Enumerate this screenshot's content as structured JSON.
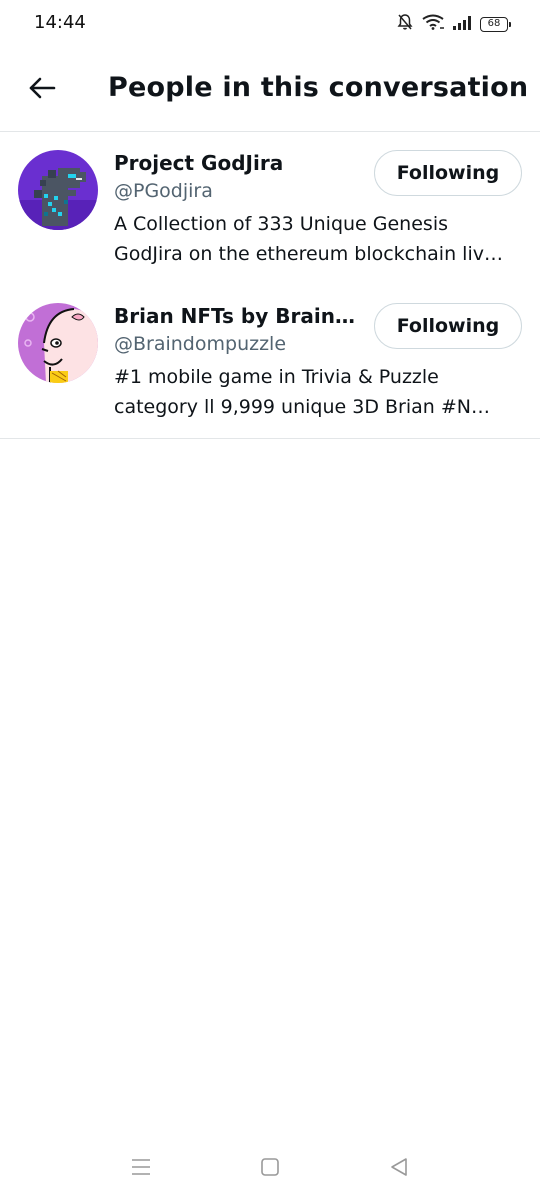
{
  "status_bar": {
    "time": "14:44",
    "battery_level": "68",
    "icons": [
      "bell-muted-icon",
      "wifi-icon",
      "signal-icon",
      "battery-icon"
    ]
  },
  "header": {
    "back_icon": "arrow-left-icon",
    "title": "People in this conversation"
  },
  "people": [
    {
      "name": "Project GodJira",
      "handle": "@PGodjira",
      "bio_line1": "A Collection of 333 Unique Genesis",
      "bio_line2": "GodJira on the ethereum blockchain liv…",
      "button_label": "Following",
      "avatar_icon": "godzilla-pixel-avatar"
    },
    {
      "name": "Brian NFTs by Braindo…",
      "handle": "@Braindompuzzle",
      "bio_line1": "#1 mobile game in Trivia & Puzzle",
      "bio_line2": "category ll  9,999 unique 3D Brian #N…",
      "button_label": "Following",
      "avatar_icon": "brian-cartoon-avatar"
    }
  ],
  "nav_bar": {
    "icons": [
      "menu-icon",
      "home-square-icon",
      "back-triangle-icon"
    ]
  },
  "colors": {
    "primary_text": "#0f1419",
    "secondary_text": "#536471",
    "divider": "#e3e6e8",
    "button_border": "#cfd9de"
  }
}
